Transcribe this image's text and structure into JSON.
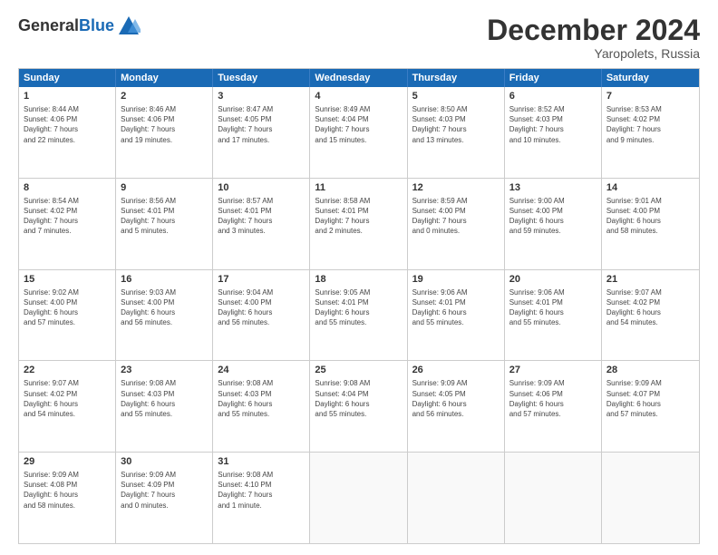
{
  "header": {
    "logo_line1": "General",
    "logo_line2": "Blue",
    "month_title": "December 2024",
    "location": "Yaropolets, Russia"
  },
  "days_of_week": [
    "Sunday",
    "Monday",
    "Tuesday",
    "Wednesday",
    "Thursday",
    "Friday",
    "Saturday"
  ],
  "weeks": [
    [
      {
        "day": "1",
        "info": "Sunrise: 8:44 AM\nSunset: 4:06 PM\nDaylight: 7 hours\nand 22 minutes."
      },
      {
        "day": "2",
        "info": "Sunrise: 8:46 AM\nSunset: 4:06 PM\nDaylight: 7 hours\nand 19 minutes."
      },
      {
        "day": "3",
        "info": "Sunrise: 8:47 AM\nSunset: 4:05 PM\nDaylight: 7 hours\nand 17 minutes."
      },
      {
        "day": "4",
        "info": "Sunrise: 8:49 AM\nSunset: 4:04 PM\nDaylight: 7 hours\nand 15 minutes."
      },
      {
        "day": "5",
        "info": "Sunrise: 8:50 AM\nSunset: 4:03 PM\nDaylight: 7 hours\nand 13 minutes."
      },
      {
        "day": "6",
        "info": "Sunrise: 8:52 AM\nSunset: 4:03 PM\nDaylight: 7 hours\nand 10 minutes."
      },
      {
        "day": "7",
        "info": "Sunrise: 8:53 AM\nSunset: 4:02 PM\nDaylight: 7 hours\nand 9 minutes."
      }
    ],
    [
      {
        "day": "8",
        "info": "Sunrise: 8:54 AM\nSunset: 4:02 PM\nDaylight: 7 hours\nand 7 minutes."
      },
      {
        "day": "9",
        "info": "Sunrise: 8:56 AM\nSunset: 4:01 PM\nDaylight: 7 hours\nand 5 minutes."
      },
      {
        "day": "10",
        "info": "Sunrise: 8:57 AM\nSunset: 4:01 PM\nDaylight: 7 hours\nand 3 minutes."
      },
      {
        "day": "11",
        "info": "Sunrise: 8:58 AM\nSunset: 4:01 PM\nDaylight: 7 hours\nand 2 minutes."
      },
      {
        "day": "12",
        "info": "Sunrise: 8:59 AM\nSunset: 4:00 PM\nDaylight: 7 hours\nand 0 minutes."
      },
      {
        "day": "13",
        "info": "Sunrise: 9:00 AM\nSunset: 4:00 PM\nDaylight: 6 hours\nand 59 minutes."
      },
      {
        "day": "14",
        "info": "Sunrise: 9:01 AM\nSunset: 4:00 PM\nDaylight: 6 hours\nand 58 minutes."
      }
    ],
    [
      {
        "day": "15",
        "info": "Sunrise: 9:02 AM\nSunset: 4:00 PM\nDaylight: 6 hours\nand 57 minutes."
      },
      {
        "day": "16",
        "info": "Sunrise: 9:03 AM\nSunset: 4:00 PM\nDaylight: 6 hours\nand 56 minutes."
      },
      {
        "day": "17",
        "info": "Sunrise: 9:04 AM\nSunset: 4:00 PM\nDaylight: 6 hours\nand 56 minutes."
      },
      {
        "day": "18",
        "info": "Sunrise: 9:05 AM\nSunset: 4:01 PM\nDaylight: 6 hours\nand 55 minutes."
      },
      {
        "day": "19",
        "info": "Sunrise: 9:06 AM\nSunset: 4:01 PM\nDaylight: 6 hours\nand 55 minutes."
      },
      {
        "day": "20",
        "info": "Sunrise: 9:06 AM\nSunset: 4:01 PM\nDaylight: 6 hours\nand 55 minutes."
      },
      {
        "day": "21",
        "info": "Sunrise: 9:07 AM\nSunset: 4:02 PM\nDaylight: 6 hours\nand 54 minutes."
      }
    ],
    [
      {
        "day": "22",
        "info": "Sunrise: 9:07 AM\nSunset: 4:02 PM\nDaylight: 6 hours\nand 54 minutes."
      },
      {
        "day": "23",
        "info": "Sunrise: 9:08 AM\nSunset: 4:03 PM\nDaylight: 6 hours\nand 55 minutes."
      },
      {
        "day": "24",
        "info": "Sunrise: 9:08 AM\nSunset: 4:03 PM\nDaylight: 6 hours\nand 55 minutes."
      },
      {
        "day": "25",
        "info": "Sunrise: 9:08 AM\nSunset: 4:04 PM\nDaylight: 6 hours\nand 55 minutes."
      },
      {
        "day": "26",
        "info": "Sunrise: 9:09 AM\nSunset: 4:05 PM\nDaylight: 6 hours\nand 56 minutes."
      },
      {
        "day": "27",
        "info": "Sunrise: 9:09 AM\nSunset: 4:06 PM\nDaylight: 6 hours\nand 57 minutes."
      },
      {
        "day": "28",
        "info": "Sunrise: 9:09 AM\nSunset: 4:07 PM\nDaylight: 6 hours\nand 57 minutes."
      }
    ],
    [
      {
        "day": "29",
        "info": "Sunrise: 9:09 AM\nSunset: 4:08 PM\nDaylight: 6 hours\nand 58 minutes."
      },
      {
        "day": "30",
        "info": "Sunrise: 9:09 AM\nSunset: 4:09 PM\nDaylight: 7 hours\nand 0 minutes."
      },
      {
        "day": "31",
        "info": "Sunrise: 9:08 AM\nSunset: 4:10 PM\nDaylight: 7 hours\nand 1 minute."
      },
      {
        "day": "",
        "info": ""
      },
      {
        "day": "",
        "info": ""
      },
      {
        "day": "",
        "info": ""
      },
      {
        "day": "",
        "info": ""
      }
    ]
  ]
}
